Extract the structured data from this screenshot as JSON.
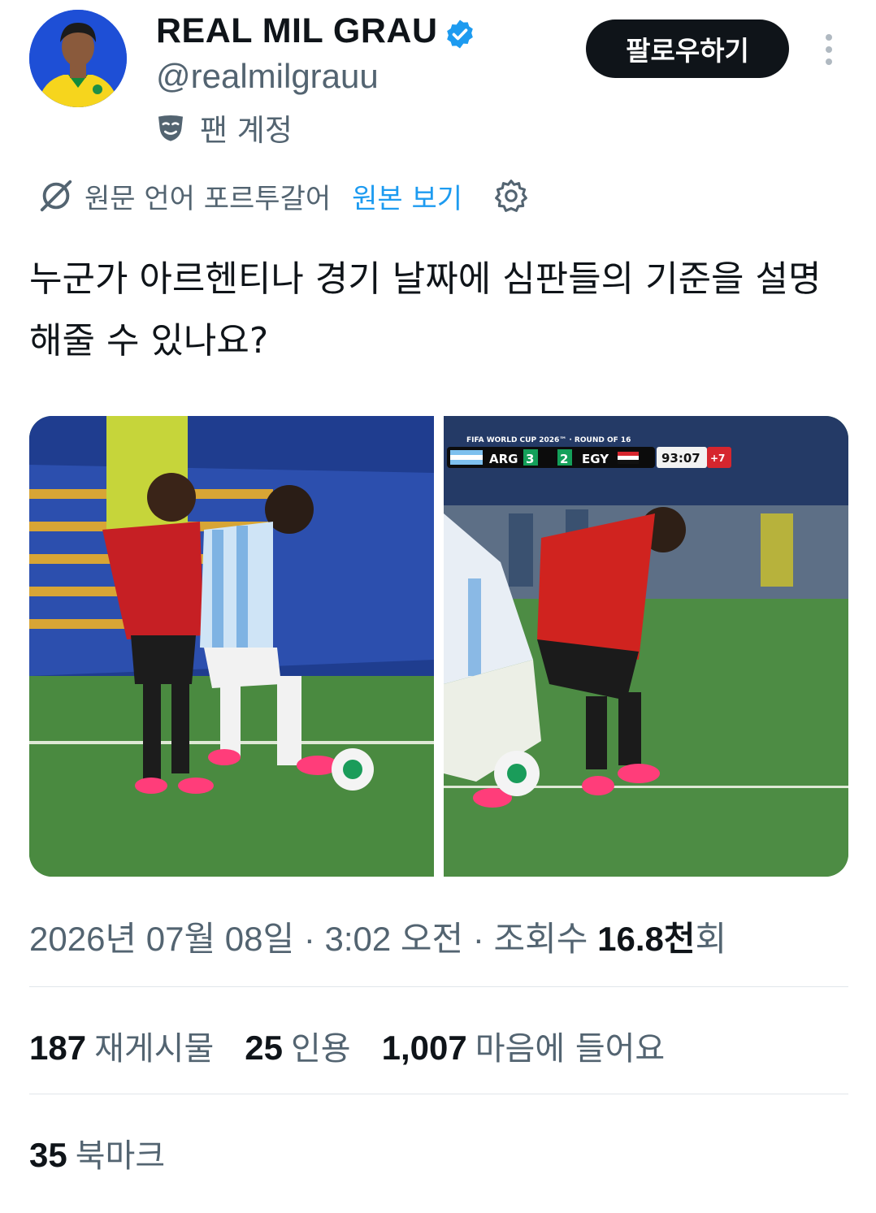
{
  "author": {
    "display_name": "REAL MIL GRAU",
    "handle": "@realmilgrauu",
    "verified": true,
    "fan_label": "팬 계정",
    "avatar_icon": "avatar-brazil-jersey",
    "colors": {
      "verified": "#1d9bf0",
      "muted": "#536471",
      "text": "#0f1419"
    }
  },
  "header": {
    "follow_label": "팔로우하기",
    "more_icon": "more-vertical-icon"
  },
  "translation": {
    "info": "원문 언어 포르투갈어",
    "view_original": "원본 보기",
    "icon": "translate-icon",
    "settings_icon": "gear-icon"
  },
  "tweet": {
    "text": "누군가 아르헨티나 경기 날짜에 심판들의 기준을 설명해줄 수 있나요?"
  },
  "media": {
    "photo_1": {
      "description_icon": "football-photo"
    },
    "photo_2": {
      "scoreboard": {
        "competition": "FIFA WORLD CUP 2026™ · ROUND OF 16",
        "home": "ARG",
        "home_score": "3",
        "away_score": "2",
        "away": "EGY",
        "clock": "93:07",
        "added": "+7"
      }
    }
  },
  "meta": {
    "date": "2026년 07월 08일",
    "time": "3:02 오전",
    "views_label": "조회수",
    "views_num": "16.8천",
    "views_suffix": "회",
    "sep": "·"
  },
  "stats": {
    "reposts_num": "187",
    "reposts_label": "재게시물",
    "quotes_num": "25",
    "quotes_label": "인용",
    "likes_num": "1,007",
    "likes_label": "마음에 들어요",
    "bookmarks_num": "35",
    "bookmarks_label": "북마크"
  }
}
